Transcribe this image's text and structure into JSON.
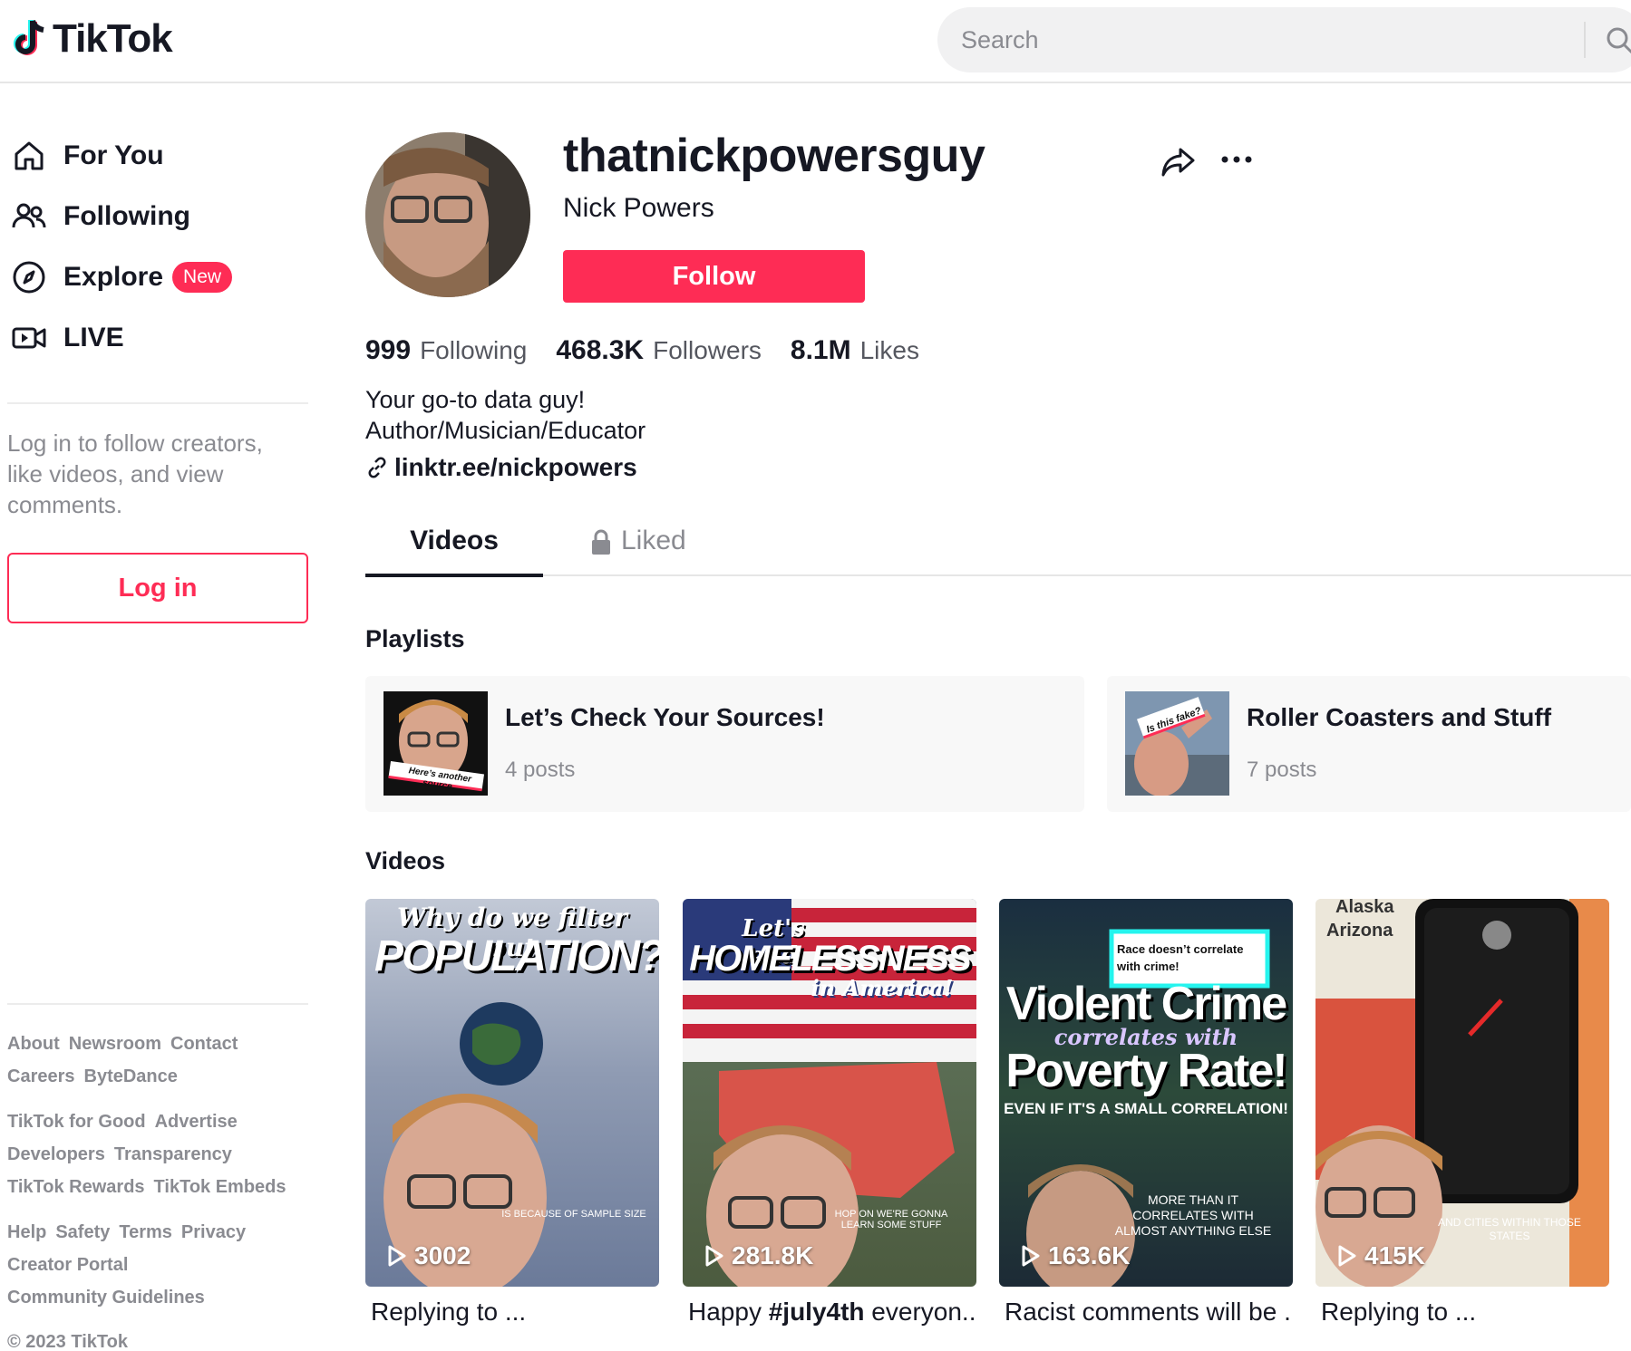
{
  "app": {
    "logo_text": "TikTok"
  },
  "search": {
    "placeholder": "Search"
  },
  "sidebar": {
    "nav": [
      {
        "label": "For You",
        "icon": "home-icon"
      },
      {
        "label": "Following",
        "icon": "people-icon"
      },
      {
        "label": "Explore",
        "icon": "compass-icon",
        "badge": "New"
      },
      {
        "label": "LIVE",
        "icon": "live-icon"
      }
    ],
    "login_prompt": "Log in to follow creators, like videos, and view comments.",
    "login_button": "Log in",
    "footer": {
      "group1": [
        "About",
        "Newsroom",
        "Contact",
        "Careers",
        "ByteDance"
      ],
      "group2": [
        "TikTok for Good",
        "Advertise",
        "Developers",
        "Transparency",
        "TikTok Rewards",
        "TikTok Embeds"
      ],
      "group3": [
        "Help",
        "Safety",
        "Terms",
        "Privacy",
        "Creator Portal",
        "Community Guidelines"
      ]
    },
    "copyright": "© 2023 TikTok"
  },
  "profile": {
    "username": "thatnickpowersguy",
    "nickname": "Nick Powers",
    "follow_button": "Follow",
    "stats": [
      {
        "value": "999",
        "label": "Following"
      },
      {
        "value": "468.3K",
        "label": "Followers"
      },
      {
        "value": "8.1M",
        "label": "Likes"
      }
    ],
    "bio_line1": "Your go-to data guy!",
    "bio_line2": "Author/Musician/Educator",
    "link": "linktr.ee/nickpowers"
  },
  "tabs": {
    "videos": "Videos",
    "liked": "Liked"
  },
  "playlists": {
    "heading": "Playlists",
    "items": [
      {
        "title": "Let’s Check Your Sources!",
        "count": "4 posts",
        "thumb_text": "Here’s another source."
      },
      {
        "title": "Roller Coasters and Stuff",
        "count": "7 posts",
        "thumb_text": "Is this fake?"
      }
    ]
  },
  "videos": {
    "heading": "Videos",
    "items": [
      {
        "views": "3002",
        "caption": "Replying to ...",
        "overlay_top": "Why do we filter out",
        "overlay_big": "POPULATION?",
        "overlay_bottom": "IS BECAUSE OF SAMPLE SIZE"
      },
      {
        "views": "281.8K",
        "caption_pre": "Happy ",
        "caption_tag": "#july4th",
        "caption_post": " everyon...",
        "overlay_top": "Let's end",
        "overlay_big": "HOMELESSNESS",
        "overlay_sub": "in America!",
        "overlay_bottom": "HOP ON WE'RE GONNA LEARN SOME STUFF"
      },
      {
        "views": "163.6K",
        "caption": "Racist comments will be ...",
        "overlay_box": "Race doesn’t correlate with crime!",
        "overlay_big1": "Violent Crime",
        "overlay_mid": "correlates with",
        "overlay_big2": "Poverty Rate!",
        "overlay_sub": "EVEN IF IT'S A SMALL CORRELATION!",
        "overlay_bottom": "MORE THAN IT CORRELATES WITH ALMOST ANYTHING ELSE"
      },
      {
        "views": "415K",
        "caption": "Replying to ...",
        "overlay_top1": "Alaska",
        "overlay_top2": "Arizona",
        "overlay_bottom": "AND CITIES WITHIN THOSE STATES"
      }
    ]
  },
  "colors": {
    "brand": "#fe2c55",
    "text": "#161823",
    "muted": "#8a8b91"
  }
}
